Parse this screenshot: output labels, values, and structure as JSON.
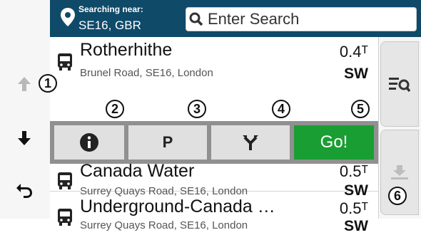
{
  "header": {
    "near_label": "Searching near:",
    "near_value": "SE16, GBR",
    "search_placeholder": "Enter Search"
  },
  "results": [
    {
      "name": "Rotherhithe",
      "address": "Brunel Road, SE16, London",
      "distance": "0.4ᵀ",
      "direction": "SW"
    },
    {
      "name": "Canada Water",
      "address": "Surrey Quays Road, SE16, London",
      "distance": "0.5ᵀ",
      "direction": "SW"
    },
    {
      "name": "Underground-Canada …",
      "address": "Surrey Quays Road, SE16, London",
      "distance": "0.5ᵀ",
      "direction": "SW"
    }
  ],
  "actions": {
    "go_label": "Go!",
    "parking_label": "P"
  },
  "callouts": [
    "1",
    "2",
    "3",
    "4",
    "5",
    "6"
  ],
  "colors": {
    "header_bg": "#0f4a69",
    "go_green": "#199e33",
    "action_bar": "#909090"
  },
  "icons": {
    "left_nav": [
      "up-arrow-icon",
      "down-arrow-icon",
      "back-arrow-icon"
    ],
    "result": "bus-icon",
    "header": "location-pin-icon",
    "search": "magnifier-icon",
    "actions": [
      "info-icon",
      "parking-icon",
      "fork-route-icon"
    ],
    "right_panel": [
      "filter-list-icon",
      "download-icon"
    ]
  }
}
